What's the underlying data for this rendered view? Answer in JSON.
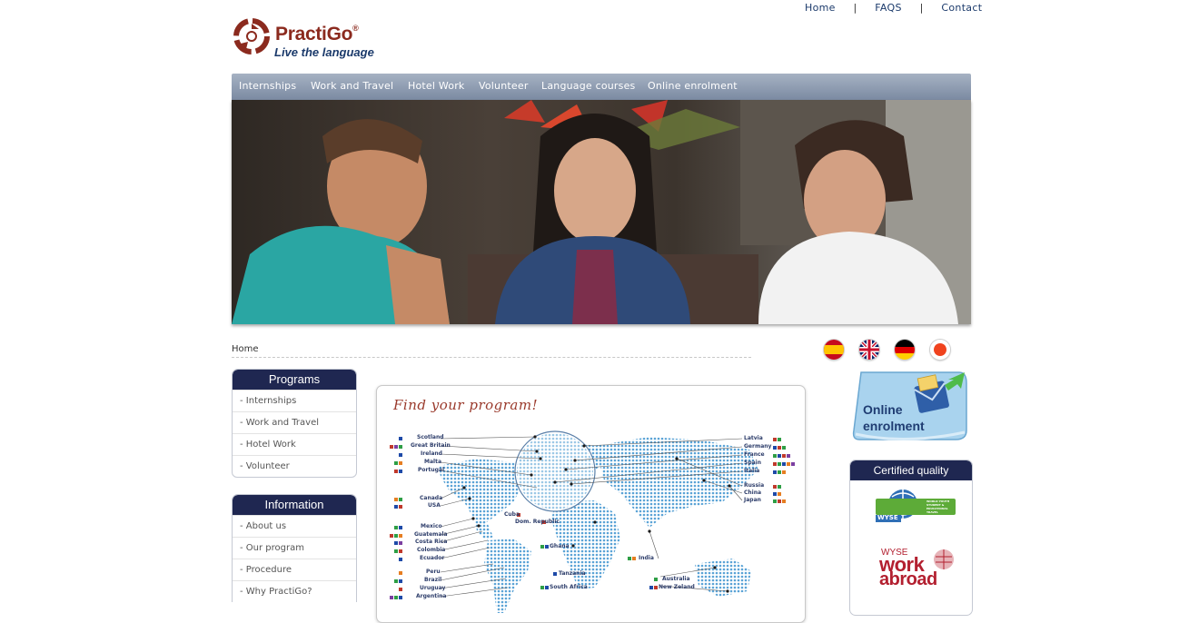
{
  "top_links": [
    "Home",
    "FAQS",
    "Contact"
  ],
  "top_separator": "|",
  "logo": {
    "brand": "PractiGo",
    "registered": "®",
    "tagline": "Live the language"
  },
  "nav": [
    "Internships",
    "Work and Travel",
    "Hotel Work",
    "Volunteer",
    "Language courses",
    "Online enrolment"
  ],
  "breadcrumb": "Home",
  "languages": [
    "spanish-flag",
    "uk-flag",
    "german-flag",
    "japan-flag"
  ],
  "programs": {
    "title": "Programs",
    "items": [
      "- Internships",
      "- Work and Travel",
      "- Hotel Work",
      "- Volunteer"
    ]
  },
  "information": {
    "title": "Information",
    "items": [
      "- About us",
      "- Our program",
      "- Procedure",
      "- Why PractiGo?"
    ]
  },
  "map": {
    "title": "Find your program!",
    "left_labels": [
      "Scotland",
      "Great Britain",
      "Ireland",
      "Malta",
      "Portugal",
      "Canada",
      "USA",
      "Mexico",
      "Guatemala",
      "Costa Rica",
      "Colombia",
      "Ecuador",
      "Peru",
      "Brazil",
      "Uruguay",
      "Argentina"
    ],
    "right_labels": [
      "Latvia",
      "Germany",
      "France",
      "Spain",
      "Italia",
      "Russia",
      "China",
      "Japan"
    ],
    "inner_labels": [
      "Cuba",
      "Dom. Republic",
      "Ghana",
      "India",
      "Tanzania",
      "South Africa",
      "Australia",
      "New Zeland"
    ]
  },
  "enrolment": {
    "line1": "Online",
    "line2": "enrolment"
  },
  "certified": {
    "title": "Certified quality",
    "wyse_confederation": "WYSE",
    "wyse_conf_text": "WORLD YOUTH STUDENT & EDUCATIONAL TRAVEL CONFEDERATION",
    "work_abroad_brand": "WYSE",
    "work_abroad_word1": "work",
    "work_abroad_word2": "abroad"
  },
  "colors": {
    "nav_bg": "#8d9bb0",
    "box_header": "#1f2751",
    "brand_red": "#8b2a1e",
    "brand_blue": "#1b3a6b"
  }
}
